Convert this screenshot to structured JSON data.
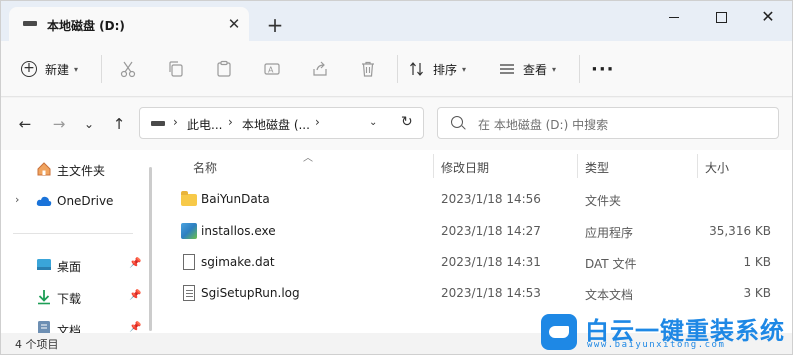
{
  "tab": {
    "title": "本地磁盘 (D:)",
    "close": "✕",
    "new_tab": "+"
  },
  "window_controls": {
    "close": "✕"
  },
  "toolbar": {
    "new_label": "新建",
    "sort_label": "排序",
    "view_label": "查看",
    "more_label": "···"
  },
  "nav": {
    "back": "←",
    "forward": "→",
    "recent": "⌄",
    "up": "↑",
    "breadcrumb": [
      "此电...",
      "本地磁盘 (..."
    ],
    "refresh": "↻",
    "search_placeholder": "在 本地磁盘 (D:) 中搜索"
  },
  "sidebar": {
    "items": [
      {
        "label": "主文件夹",
        "icon": "home-icon"
      },
      {
        "label": "OneDrive",
        "icon": "cloud-icon"
      },
      {
        "label": "桌面",
        "icon": "desktop-icon"
      },
      {
        "label": "下载",
        "icon": "download-icon"
      },
      {
        "label": "文档",
        "icon": "documents-icon"
      }
    ]
  },
  "columns": {
    "name": "名称",
    "modified": "修改日期",
    "type": "类型",
    "size": "大小"
  },
  "files": [
    {
      "name": "BaiYunData",
      "modified": "2023/1/18 14:56",
      "type": "文件夹",
      "size": "",
      "icon": "folder-icon"
    },
    {
      "name": "installos.exe",
      "modified": "2023/1/18 14:27",
      "type": "应用程序",
      "size": "35,316 KB",
      "icon": "exe-icon"
    },
    {
      "name": "sgimake.dat",
      "modified": "2023/1/18 14:31",
      "type": "DAT 文件",
      "size": "1 KB",
      "icon": "file-icon"
    },
    {
      "name": "SgiSetupRun.log",
      "modified": "2023/1/18 14:53",
      "type": "文本文档",
      "size": "3 KB",
      "icon": "text-file-icon"
    }
  ],
  "status": {
    "item_count": "4 个项目"
  },
  "watermark": {
    "brand": "白云一键重装系统",
    "url": "www.baiyunxitong.com"
  },
  "colors": {
    "accent": "#1e88e5",
    "folder": "#f7c948"
  }
}
